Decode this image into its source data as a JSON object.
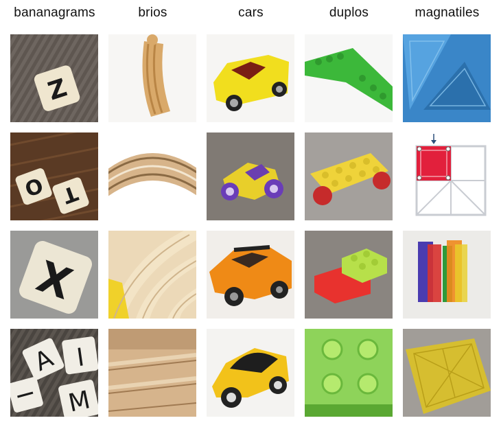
{
  "columns": [
    {
      "label": "bananagrams"
    },
    {
      "label": "brios"
    },
    {
      "label": "cars"
    },
    {
      "label": "duplos"
    },
    {
      "label": "magnatiles"
    }
  ],
  "tiles": {
    "bananagrams": [
      {
        "letter": "Z"
      },
      {
        "letters": [
          "O",
          "T"
        ]
      },
      {
        "letter": "X"
      },
      {
        "letters": [
          "A",
          "I",
          "I",
          "M"
        ]
      }
    ]
  }
}
